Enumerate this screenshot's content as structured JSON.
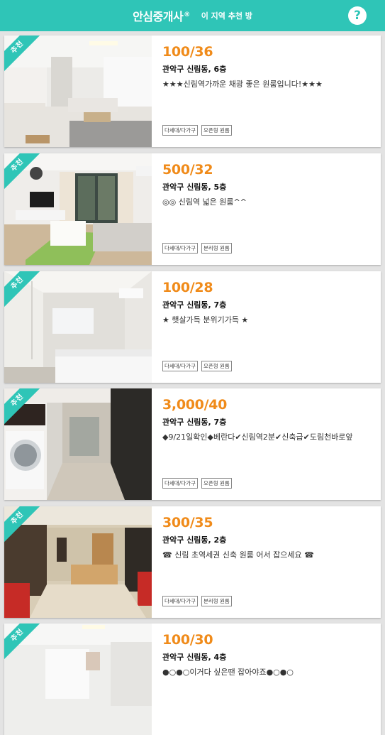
{
  "header": {
    "brand": "안심중개사",
    "brand_mark": "®",
    "subtitle": "이 지역 추천 방",
    "help_icon": "help-icon"
  },
  "colors": {
    "accent": "#2fc5b7",
    "price": "#f08b1a"
  },
  "listings": [
    {
      "badge": "추천",
      "price": "100/36",
      "location": "관악구 신림동, 6층",
      "description": "★★★신림역가까운 채광 좋은 원룸입니다!★★★",
      "tags": [
        "다세대/다가구",
        "오픈형 원룸"
      ]
    },
    {
      "badge": "추천",
      "price": "500/32",
      "location": "관악구 신림동, 5층",
      "description": "◎◎ 신림역 넓은 원룸^^",
      "tags": [
        "다세대/다가구",
        "분리형 원룸"
      ]
    },
    {
      "badge": "추천",
      "price": "100/28",
      "location": "관악구 신림동, 7층",
      "description": "★ 햇살가득 분위기가득 ★",
      "tags": [
        "다세대/다가구",
        "오픈형 원룸"
      ]
    },
    {
      "badge": "추천",
      "price": "3,000/40",
      "location": "관악구 신림동, 7층",
      "description": "◆9/21일확인◆베란다✔신림역2분✔신축급✔도림천바로앞",
      "tags": [
        "다세대/다가구",
        "오픈형 원룸"
      ]
    },
    {
      "badge": "추천",
      "price": "300/35",
      "location": "관악구 신림동, 2층",
      "description": "☎ 신림 초역세권 신축 원룸 어서 잡으세요 ☎",
      "tags": [
        "다세대/다가구",
        "분리형 원룸"
      ]
    },
    {
      "badge": "추천",
      "price": "100/30",
      "location": "관악구 신림동, 4층",
      "description": "●○●○이거다 싶은땐 잡아야죠●○●○",
      "tags": []
    }
  ]
}
